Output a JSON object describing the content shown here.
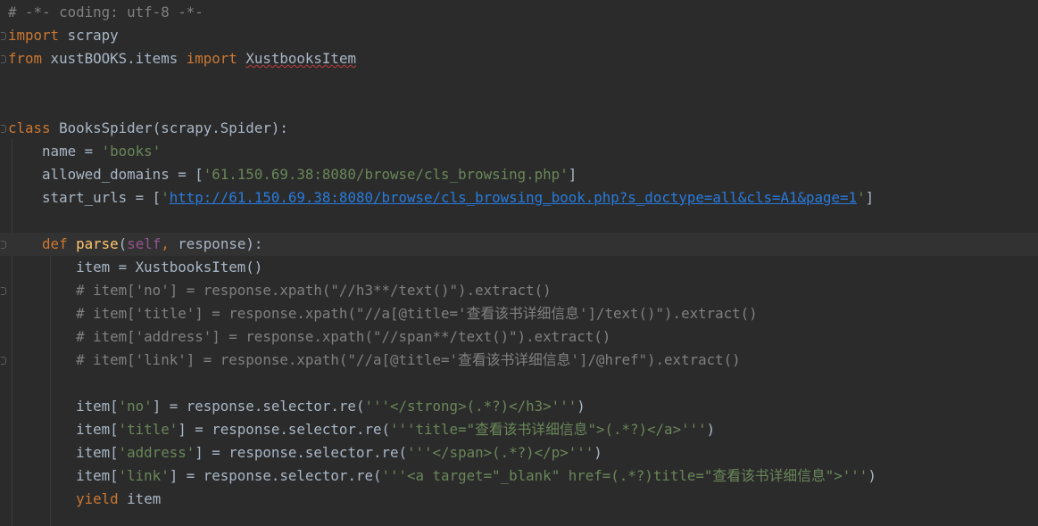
{
  "editor": {
    "language": "python",
    "theme": "darcula",
    "colors": {
      "background": "#2b2b2b",
      "current_line": "#323232",
      "keyword": "#cc7832",
      "string": "#6a8759",
      "comment": "#808080",
      "function": "#ffc66d",
      "self": "#94558d",
      "default": "#a9b7c6",
      "link": "#287bde",
      "error_underline": "#bc3f3c"
    },
    "lines": [
      {
        "segments": [
          {
            "t": "# -*- coding: utf-8 -*-",
            "c": "cm"
          }
        ]
      },
      {
        "fold": true,
        "segments": [
          {
            "t": "import",
            "c": "kw"
          },
          {
            "t": " scrapy"
          }
        ]
      },
      {
        "fold": true,
        "segments": [
          {
            "t": "from",
            "c": "kw"
          },
          {
            "t": " xustBOOKS.items "
          },
          {
            "t": "import",
            "c": "kw"
          },
          {
            "t": " "
          },
          {
            "t": "XustbooksItem",
            "c": "warn"
          }
        ]
      },
      {
        "segments": []
      },
      {
        "segments": []
      },
      {
        "fold": true,
        "segments": [
          {
            "t": "class",
            "c": "kw"
          },
          {
            "t": " BooksSpider(scrapy.Spider):"
          }
        ]
      },
      {
        "segments": [
          {
            "t": "    name = "
          },
          {
            "t": "'books'",
            "c": "str"
          }
        ]
      },
      {
        "segments": [
          {
            "t": "    allowed_domains = ["
          },
          {
            "t": "'61.150.69.38:8080/browse/cls_browsing.php'",
            "c": "str"
          },
          {
            "t": "]"
          }
        ]
      },
      {
        "segments": [
          {
            "t": "    start_urls = ["
          },
          {
            "t": "'",
            "c": "str"
          },
          {
            "t": "http://61.150.69.38:8080/browse/cls_browsing_book.php?s_doctype=all&cls=A1&page=1",
            "c": "url"
          },
          {
            "t": "'",
            "c": "str"
          },
          {
            "t": "]"
          }
        ]
      },
      {
        "segments": []
      },
      {
        "fold": true,
        "current": true,
        "segments": [
          {
            "t": "    "
          },
          {
            "t": "def",
            "c": "kw"
          },
          {
            "t": " "
          },
          {
            "t": "parse",
            "c": "fn"
          },
          {
            "t": "("
          },
          {
            "t": "self",
            "c": "self"
          },
          {
            "t": ", ",
            "c": "kw"
          },
          {
            "t": "response):"
          }
        ]
      },
      {
        "segments": [
          {
            "t": "        item = XustbooksItem()"
          }
        ]
      },
      {
        "fold": true,
        "segments": [
          {
            "t": "        # item['no'] = response.xpath(\"//h3**/text()\").extract()",
            "c": "cm"
          }
        ]
      },
      {
        "segments": [
          {
            "t": "        # item['title'] = response.xpath(\"//a[@title='查看该书详细信息']/text()\").extract()",
            "c": "cm"
          }
        ]
      },
      {
        "segments": [
          {
            "t": "        # item['address'] = response.xpath(\"//span**/text()\").extract()",
            "c": "cm"
          }
        ]
      },
      {
        "fold": true,
        "segments": [
          {
            "t": "        # item['link'] = response.xpath(\"//a[@title='查看该书详细信息']/@href\").extract()",
            "c": "cm"
          }
        ]
      },
      {
        "segments": []
      },
      {
        "segments": [
          {
            "t": "        item["
          },
          {
            "t": "'no'",
            "c": "str"
          },
          {
            "t": "] = response.selector.re("
          },
          {
            "t": "'''</strong>(.*?)</h3>'''",
            "c": "str"
          },
          {
            "t": ")"
          }
        ]
      },
      {
        "segments": [
          {
            "t": "        item["
          },
          {
            "t": "'title'",
            "c": "str"
          },
          {
            "t": "] = response.selector.re("
          },
          {
            "t": "'''title=\"查看该书详细信息\">(.*?)</a>'''",
            "c": "str"
          },
          {
            "t": ")"
          }
        ]
      },
      {
        "segments": [
          {
            "t": "        item["
          },
          {
            "t": "'address'",
            "c": "str"
          },
          {
            "t": "] = response.selector.re("
          },
          {
            "t": "'''</span>(.*?)</p>'''",
            "c": "str"
          },
          {
            "t": ")"
          }
        ]
      },
      {
        "segments": [
          {
            "t": "        item["
          },
          {
            "t": "'link'",
            "c": "str"
          },
          {
            "t": "] = response.selector.re("
          },
          {
            "t": "'''<a target=\"_blank\" href=(.*?)title=\"查看该书详细信息\">'''",
            "c": "str"
          },
          {
            "t": ")"
          }
        ]
      },
      {
        "segments": [
          {
            "t": "        "
          },
          {
            "t": "yield",
            "c": "kw"
          },
          {
            "t": " item"
          }
        ]
      }
    ]
  }
}
